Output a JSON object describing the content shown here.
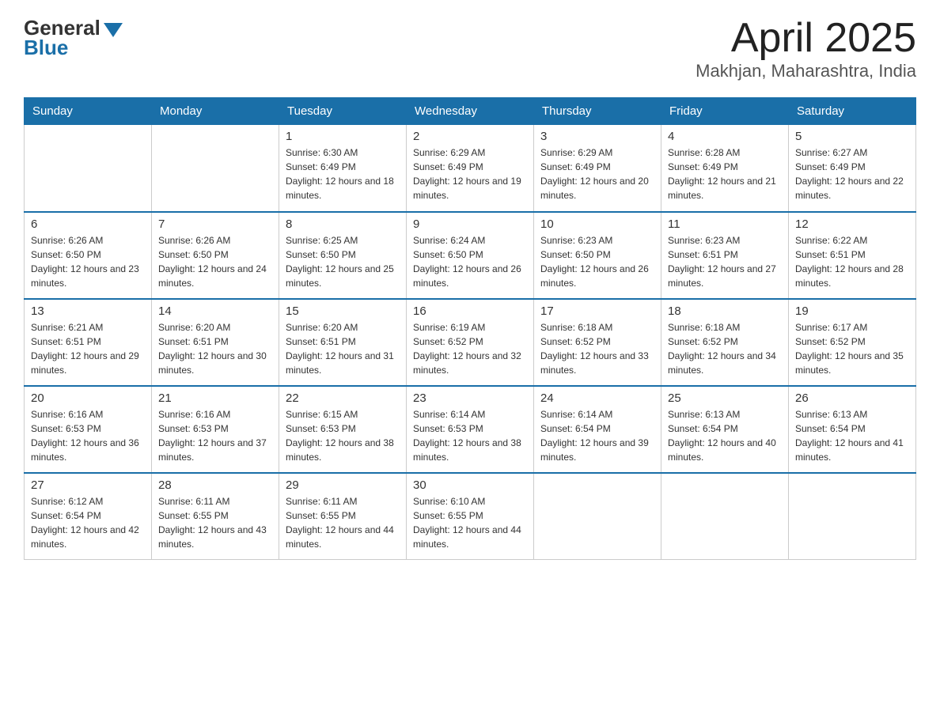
{
  "header": {
    "logo": {
      "general": "General",
      "blue": "Blue",
      "line2": "Blue"
    },
    "title": "April 2025",
    "location": "Makhjan, Maharashtra, India"
  },
  "calendar": {
    "days_of_week": [
      "Sunday",
      "Monday",
      "Tuesday",
      "Wednesday",
      "Thursday",
      "Friday",
      "Saturday"
    ],
    "weeks": [
      [
        {
          "day": "",
          "sunrise": "",
          "sunset": "",
          "daylight": ""
        },
        {
          "day": "",
          "sunrise": "",
          "sunset": "",
          "daylight": ""
        },
        {
          "day": "1",
          "sunrise": "Sunrise: 6:30 AM",
          "sunset": "Sunset: 6:49 PM",
          "daylight": "Daylight: 12 hours and 18 minutes."
        },
        {
          "day": "2",
          "sunrise": "Sunrise: 6:29 AM",
          "sunset": "Sunset: 6:49 PM",
          "daylight": "Daylight: 12 hours and 19 minutes."
        },
        {
          "day": "3",
          "sunrise": "Sunrise: 6:29 AM",
          "sunset": "Sunset: 6:49 PM",
          "daylight": "Daylight: 12 hours and 20 minutes."
        },
        {
          "day": "4",
          "sunrise": "Sunrise: 6:28 AM",
          "sunset": "Sunset: 6:49 PM",
          "daylight": "Daylight: 12 hours and 21 minutes."
        },
        {
          "day": "5",
          "sunrise": "Sunrise: 6:27 AM",
          "sunset": "Sunset: 6:49 PM",
          "daylight": "Daylight: 12 hours and 22 minutes."
        }
      ],
      [
        {
          "day": "6",
          "sunrise": "Sunrise: 6:26 AM",
          "sunset": "Sunset: 6:50 PM",
          "daylight": "Daylight: 12 hours and 23 minutes."
        },
        {
          "day": "7",
          "sunrise": "Sunrise: 6:26 AM",
          "sunset": "Sunset: 6:50 PM",
          "daylight": "Daylight: 12 hours and 24 minutes."
        },
        {
          "day": "8",
          "sunrise": "Sunrise: 6:25 AM",
          "sunset": "Sunset: 6:50 PM",
          "daylight": "Daylight: 12 hours and 25 minutes."
        },
        {
          "day": "9",
          "sunrise": "Sunrise: 6:24 AM",
          "sunset": "Sunset: 6:50 PM",
          "daylight": "Daylight: 12 hours and 26 minutes."
        },
        {
          "day": "10",
          "sunrise": "Sunrise: 6:23 AM",
          "sunset": "Sunset: 6:50 PM",
          "daylight": "Daylight: 12 hours and 26 minutes."
        },
        {
          "day": "11",
          "sunrise": "Sunrise: 6:23 AM",
          "sunset": "Sunset: 6:51 PM",
          "daylight": "Daylight: 12 hours and 27 minutes."
        },
        {
          "day": "12",
          "sunrise": "Sunrise: 6:22 AM",
          "sunset": "Sunset: 6:51 PM",
          "daylight": "Daylight: 12 hours and 28 minutes."
        }
      ],
      [
        {
          "day": "13",
          "sunrise": "Sunrise: 6:21 AM",
          "sunset": "Sunset: 6:51 PM",
          "daylight": "Daylight: 12 hours and 29 minutes."
        },
        {
          "day": "14",
          "sunrise": "Sunrise: 6:20 AM",
          "sunset": "Sunset: 6:51 PM",
          "daylight": "Daylight: 12 hours and 30 minutes."
        },
        {
          "day": "15",
          "sunrise": "Sunrise: 6:20 AM",
          "sunset": "Sunset: 6:51 PM",
          "daylight": "Daylight: 12 hours and 31 minutes."
        },
        {
          "day": "16",
          "sunrise": "Sunrise: 6:19 AM",
          "sunset": "Sunset: 6:52 PM",
          "daylight": "Daylight: 12 hours and 32 minutes."
        },
        {
          "day": "17",
          "sunrise": "Sunrise: 6:18 AM",
          "sunset": "Sunset: 6:52 PM",
          "daylight": "Daylight: 12 hours and 33 minutes."
        },
        {
          "day": "18",
          "sunrise": "Sunrise: 6:18 AM",
          "sunset": "Sunset: 6:52 PM",
          "daylight": "Daylight: 12 hours and 34 minutes."
        },
        {
          "day": "19",
          "sunrise": "Sunrise: 6:17 AM",
          "sunset": "Sunset: 6:52 PM",
          "daylight": "Daylight: 12 hours and 35 minutes."
        }
      ],
      [
        {
          "day": "20",
          "sunrise": "Sunrise: 6:16 AM",
          "sunset": "Sunset: 6:53 PM",
          "daylight": "Daylight: 12 hours and 36 minutes."
        },
        {
          "day": "21",
          "sunrise": "Sunrise: 6:16 AM",
          "sunset": "Sunset: 6:53 PM",
          "daylight": "Daylight: 12 hours and 37 minutes."
        },
        {
          "day": "22",
          "sunrise": "Sunrise: 6:15 AM",
          "sunset": "Sunset: 6:53 PM",
          "daylight": "Daylight: 12 hours and 38 minutes."
        },
        {
          "day": "23",
          "sunrise": "Sunrise: 6:14 AM",
          "sunset": "Sunset: 6:53 PM",
          "daylight": "Daylight: 12 hours and 38 minutes."
        },
        {
          "day": "24",
          "sunrise": "Sunrise: 6:14 AM",
          "sunset": "Sunset: 6:54 PM",
          "daylight": "Daylight: 12 hours and 39 minutes."
        },
        {
          "day": "25",
          "sunrise": "Sunrise: 6:13 AM",
          "sunset": "Sunset: 6:54 PM",
          "daylight": "Daylight: 12 hours and 40 minutes."
        },
        {
          "day": "26",
          "sunrise": "Sunrise: 6:13 AM",
          "sunset": "Sunset: 6:54 PM",
          "daylight": "Daylight: 12 hours and 41 minutes."
        }
      ],
      [
        {
          "day": "27",
          "sunrise": "Sunrise: 6:12 AM",
          "sunset": "Sunset: 6:54 PM",
          "daylight": "Daylight: 12 hours and 42 minutes."
        },
        {
          "day": "28",
          "sunrise": "Sunrise: 6:11 AM",
          "sunset": "Sunset: 6:55 PM",
          "daylight": "Daylight: 12 hours and 43 minutes."
        },
        {
          "day": "29",
          "sunrise": "Sunrise: 6:11 AM",
          "sunset": "Sunset: 6:55 PM",
          "daylight": "Daylight: 12 hours and 44 minutes."
        },
        {
          "day": "30",
          "sunrise": "Sunrise: 6:10 AM",
          "sunset": "Sunset: 6:55 PM",
          "daylight": "Daylight: 12 hours and 44 minutes."
        },
        {
          "day": "",
          "sunrise": "",
          "sunset": "",
          "daylight": ""
        },
        {
          "day": "",
          "sunrise": "",
          "sunset": "",
          "daylight": ""
        },
        {
          "day": "",
          "sunrise": "",
          "sunset": "",
          "daylight": ""
        }
      ]
    ]
  }
}
